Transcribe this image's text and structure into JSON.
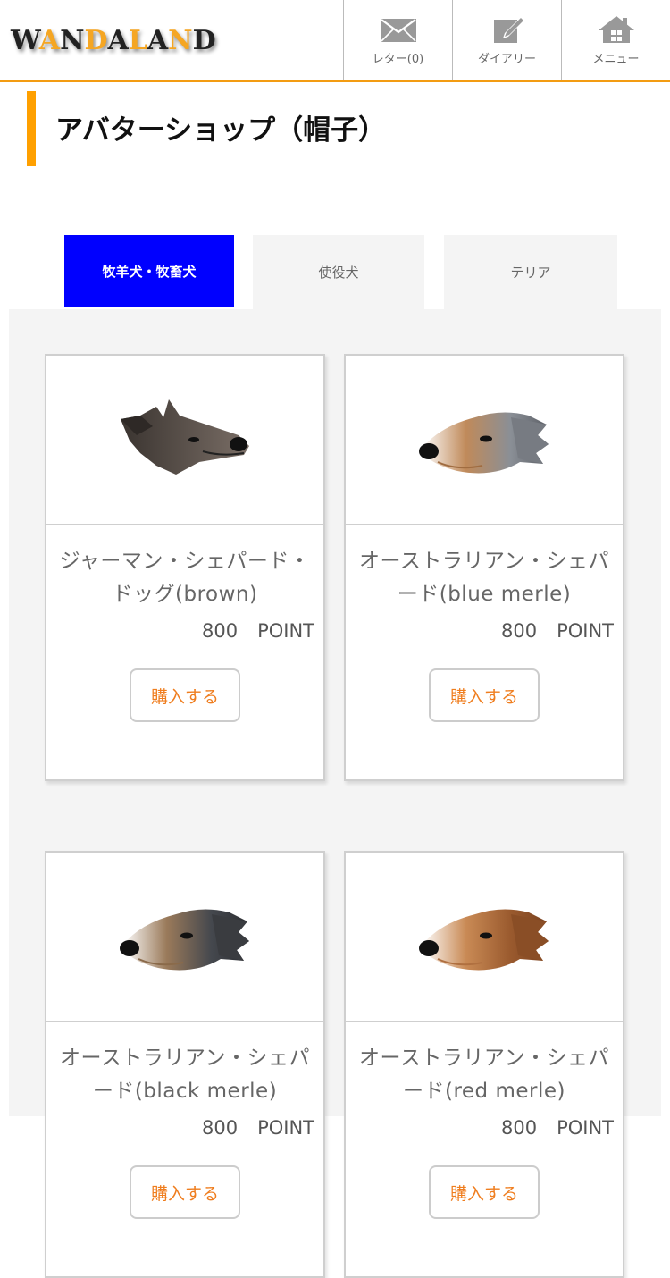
{
  "header": {
    "logo_parts": [
      "W",
      "A",
      "N",
      "D",
      "A",
      "L",
      "A",
      "N",
      "D"
    ],
    "nav": [
      {
        "label": "レター(0)",
        "icon": "envelope-icon"
      },
      {
        "label": "ダイアリー",
        "icon": "pencil-note-icon"
      },
      {
        "label": "メニュー",
        "icon": "home-icon"
      }
    ]
  },
  "page": {
    "title": "アバターショップ（帽子）"
  },
  "tabs": [
    {
      "label": "牧羊犬・牧畜犬",
      "active": true
    },
    {
      "label": "使役犬",
      "active": false
    },
    {
      "label": "テリア",
      "active": false
    }
  ],
  "products": [
    {
      "name": "ジャーマン・シェパード・ドッグ(brown)",
      "price": "800",
      "unit": "POINT",
      "buy_label": "購入する",
      "image": "german-shepherd-brown-head"
    },
    {
      "name": "オーストラリアン・シェパード(blue merle)",
      "price": "800",
      "unit": "POINT",
      "buy_label": "購入する",
      "image": "australian-shepherd-blue-merle-head"
    },
    {
      "name": "オーストラリアン・シェパード(black merle)",
      "price": "800",
      "unit": "POINT",
      "buy_label": "購入する",
      "image": "australian-shepherd-black-merle-head"
    },
    {
      "name": "オーストラリアン・シェパード(red merle)",
      "price": "800",
      "unit": "POINT",
      "buy_label": "購入する",
      "image": "australian-shepherd-red-merle-head"
    }
  ],
  "colors": {
    "accent": "#f39c12",
    "tab_active": "#0000ff",
    "buy_text": "#ef7d1e",
    "panel_bg": "#f4f4f4"
  }
}
